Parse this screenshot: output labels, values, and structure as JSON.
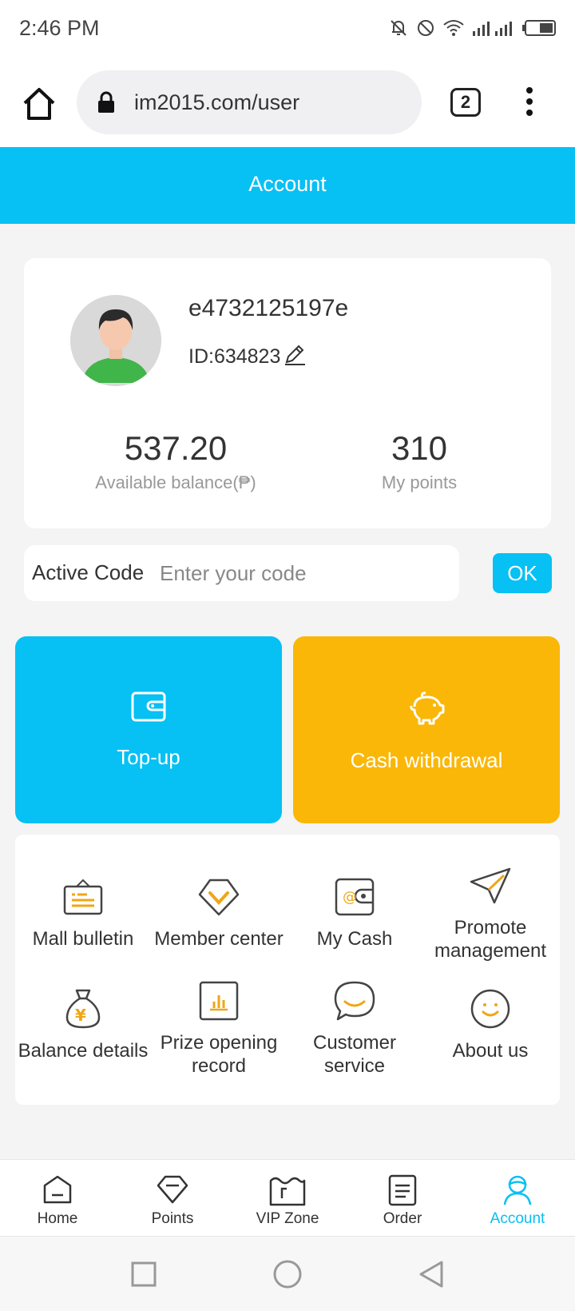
{
  "status_bar": {
    "time": "2:46 PM"
  },
  "browser": {
    "url": "im2015.com/user",
    "tab_count": "2"
  },
  "header": {
    "title": "Account"
  },
  "profile": {
    "username": "e4732125197e",
    "user_id": "ID:634823",
    "balance_value": "537.20",
    "balance_label": "Available balance(₱)",
    "points_value": "310",
    "points_label": "My points"
  },
  "active_code": {
    "label": "Active Code",
    "placeholder": "Enter your code",
    "button": "OK"
  },
  "tiles": {
    "topup": "Top-up",
    "cash": "Cash withdrawal"
  },
  "grid": {
    "items": [
      {
        "label": "Mall bulletin",
        "icon": "bulletin-icon"
      },
      {
        "label": "Member center",
        "icon": "diamond-icon"
      },
      {
        "label": "My Cash",
        "icon": "wallet-icon"
      },
      {
        "label": "Promote management",
        "icon": "paper-plane-icon"
      },
      {
        "label": "Balance details",
        "icon": "money-bag-icon"
      },
      {
        "label": "Prize opening record",
        "icon": "bar-chart-icon"
      },
      {
        "label": "Customer service",
        "icon": "chat-bubble-icon"
      },
      {
        "label": "About us",
        "icon": "smile-icon"
      }
    ]
  },
  "bottom_nav": {
    "items": [
      {
        "label": "Home"
      },
      {
        "label": "Points"
      },
      {
        "label": "VIP Zone"
      },
      {
        "label": "Order"
      },
      {
        "label": "Account"
      }
    ]
  },
  "colors": {
    "accent": "#07c0f4",
    "cash": "#fab708",
    "icon_gold": "#f0a616"
  }
}
